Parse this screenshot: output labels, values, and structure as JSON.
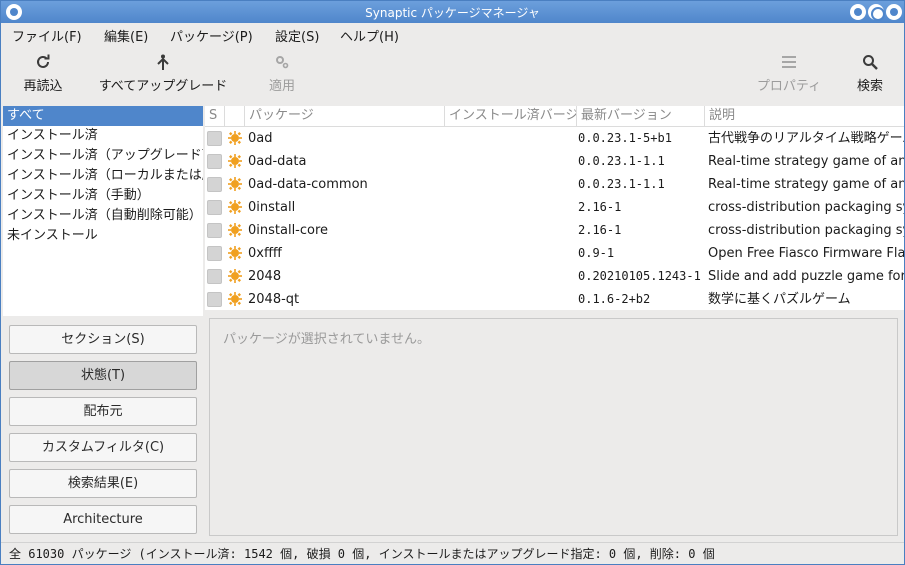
{
  "window": {
    "title": "Synaptic パッケージマネージャ"
  },
  "menu": [
    {
      "label": "ファイル(F)"
    },
    {
      "label": "編集(E)"
    },
    {
      "label": "パッケージ(P)"
    },
    {
      "label": "設定(S)"
    },
    {
      "label": "ヘルプ(H)"
    }
  ],
  "toolbar": {
    "reload": {
      "label": "再読込",
      "icon": "reload-icon"
    },
    "upgrade_all": {
      "label": "すべてアップグレード",
      "icon": "upgrade-icon"
    },
    "apply": {
      "label": "適用",
      "icon": "gear-icon"
    },
    "properties": {
      "label": "プロパティ",
      "icon": "list-icon"
    },
    "search": {
      "label": "検索",
      "icon": "search-icon"
    }
  },
  "filters": {
    "items": [
      {
        "label": "すべて"
      },
      {
        "label": "インストール済"
      },
      {
        "label": "インストール済（アップグレード可能）"
      },
      {
        "label": "インストール済（ローカルまたは廃止）"
      },
      {
        "label": "インストール済（手動）"
      },
      {
        "label": "インストール済（自動削除可能）"
      },
      {
        "label": "未インストール"
      }
    ],
    "selected_index": 0
  },
  "filter_buttons": [
    {
      "label": "セクション(S)"
    },
    {
      "label": "状態(T)"
    },
    {
      "label": "配布元"
    },
    {
      "label": "カスタムフィルタ(C)"
    },
    {
      "label": "検索結果(E)"
    },
    {
      "label": "Architecture"
    }
  ],
  "table": {
    "columns": {
      "s": "S",
      "package": "パッケージ",
      "installed": "インストール済バージョン",
      "latest": "最新バージョン",
      "description": "説明"
    },
    "rows": [
      {
        "package": "0ad",
        "installed": "",
        "latest": "0.0.23.1-5+b1",
        "description": "古代戦争のリアルタイム戦略ゲーム"
      },
      {
        "package": "0ad-data",
        "installed": "",
        "latest": "0.0.23.1-1.1",
        "description": "Real-time strategy game of ancient warfare (data files)"
      },
      {
        "package": "0ad-data-common",
        "installed": "",
        "latest": "0.0.23.1-1.1",
        "description": "Real-time strategy game of ancient warfare (common data files)"
      },
      {
        "package": "0install",
        "installed": "",
        "latest": "2.16-1",
        "description": "cross-distribution packaging system"
      },
      {
        "package": "0install-core",
        "installed": "",
        "latest": "2.16-1",
        "description": "cross-distribution packaging system (core)"
      },
      {
        "package": "0xffff",
        "installed": "",
        "latest": "0.9-1",
        "description": "Open Free Fiasco Firmware Flasher"
      },
      {
        "package": "2048",
        "installed": "",
        "latest": "0.20210105.1243-1",
        "description": "Slide and add puzzle game for text mode"
      },
      {
        "package": "2048-qt",
        "installed": "",
        "latest": "0.1.6-2+b2",
        "description": "数学に基くパズルゲーム"
      }
    ]
  },
  "details": {
    "message": "パッケージが選択されていません。"
  },
  "status": {
    "text": "全 61030 パッケージ (インストール済: 1542 個, 破損 0 個, インストールまたはアップグレード指定: 0 個, 削除: 0 個"
  },
  "colors": {
    "accent": "#4f86cb",
    "status_icon": "#f0a020"
  }
}
